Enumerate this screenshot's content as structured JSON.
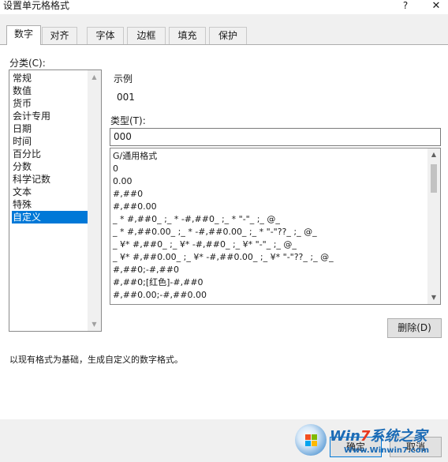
{
  "window": {
    "title": "设置单元格格式",
    "help_glyph": "?",
    "close_glyph": "✕"
  },
  "tabs": [
    {
      "label": "数字"
    },
    {
      "label": "对齐"
    },
    {
      "label": "字体"
    },
    {
      "label": "边框"
    },
    {
      "label": "填充"
    },
    {
      "label": "保护"
    }
  ],
  "category": {
    "label": "分类(C):",
    "items": [
      "常规",
      "数值",
      "货币",
      "会计专用",
      "日期",
      "时间",
      "百分比",
      "分数",
      "科学记数",
      "文本",
      "特殊",
      "自定义"
    ],
    "selected": "自定义"
  },
  "sample": {
    "label": "示例",
    "value": "001"
  },
  "type": {
    "label": "类型(T):",
    "value": "000"
  },
  "formats": [
    "G/通用格式",
    "0",
    "0.00",
    "#,##0",
    "#,##0.00",
    "_ * #,##0_ ;_ * -#,##0_ ;_ * \"-\"_ ;_ @_",
    "_ * #,##0.00_ ;_ * -#,##0.00_ ;_ * \"-\"??_ ;_ @_",
    "_ ¥* #,##0_ ;_ ¥* -#,##0_ ;_ ¥* \"-\"_ ;_ @_",
    "_ ¥* #,##0.00_ ;_ ¥* -#,##0.00_ ;_ ¥* \"-\"??_ ;_ @_",
    "#,##0;-#,##0",
    "#,##0;[红色]-#,##0",
    "#,##0.00;-#,##0.00"
  ],
  "buttons": {
    "delete": "删除(D)",
    "ok": "确定",
    "cancel": "取消"
  },
  "description": "以现有格式为基础，生成自定义的数字格式。",
  "watermark": {
    "brand_prefix": "Win",
    "brand_seven": "7",
    "brand_suffix": "系统之家",
    "site": "Www.Winwin7.com"
  },
  "colors": {
    "selection": "#0078d7",
    "panel": "#ffffff",
    "chrome": "#f0f0f0"
  },
  "icons": {
    "scroll_up": "▲",
    "scroll_down": "▼"
  }
}
